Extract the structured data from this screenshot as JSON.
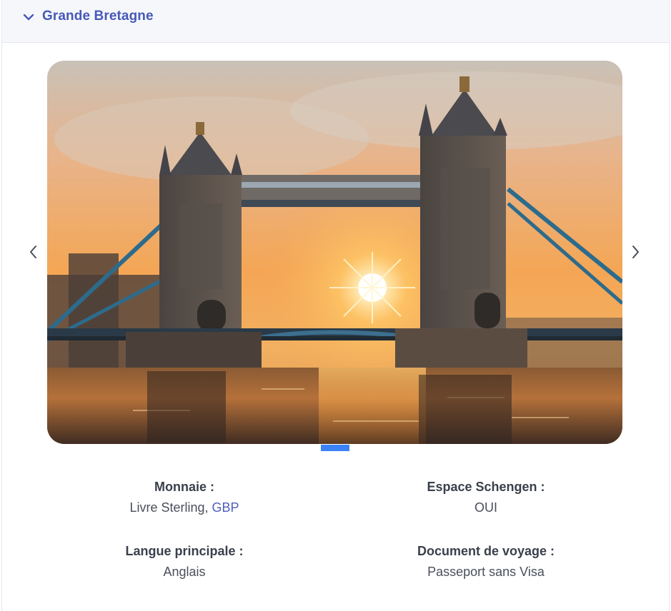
{
  "accordion": {
    "title": "Grande Bretagne",
    "expanded": true,
    "toggle_icon": "chevron-down-icon"
  },
  "carousel": {
    "image_subject": "Tower Bridge at sunset over the Thames",
    "prev_icon": "chevron-left-icon",
    "next_icon": "chevron-right-icon",
    "active_slide": 1,
    "indicator_color": "#3b82f6"
  },
  "info": {
    "currency": {
      "label": "Monnaie :",
      "value_text": "Livre Sterling,",
      "value_code": "GBP"
    },
    "schengen": {
      "label": "Espace Schengen :",
      "value": "OUI"
    },
    "language": {
      "label": "Langue principale :",
      "value": "Anglais"
    },
    "travel_document": {
      "label": "Document de voyage :",
      "value": "Passeport sans Visa"
    }
  },
  "colors": {
    "accent": "#4659b8",
    "link": "#4e5fba",
    "header_bg": "#f6f7fa"
  }
}
